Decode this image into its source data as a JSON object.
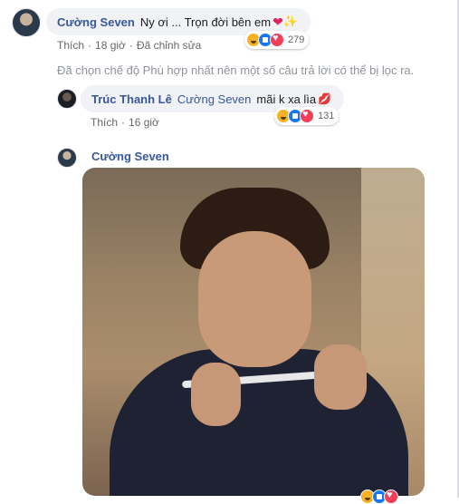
{
  "comments": [
    {
      "author": "Cường Seven",
      "text": "Ny ơi ... Trọn đời bên em",
      "emoji": "❤️✨",
      "like_label": "Thích",
      "time": "18 giờ",
      "edited": "Đã chỉnh sửa",
      "reaction_count": "279"
    }
  ],
  "filter_note": "Đã chọn chế độ Phù hợp nhất nên một số câu trả lời có thể bị lọc ra.",
  "reply": {
    "author": "Trúc Thanh Lê",
    "mention": "Cường Seven",
    "text": "mãi k xa lìa",
    "emoji": "💋",
    "like_label": "Thích",
    "time": "16 giờ",
    "reaction_count": "131"
  },
  "gif_reply": {
    "author": "Cường Seven"
  },
  "colors": {
    "link": "#385898",
    "bubble": "#f0f2f5",
    "meta": "#65676b"
  },
  "icons": {
    "haha": "haha-reaction-icon",
    "like": "like-reaction-icon",
    "love": "love-reaction-icon"
  }
}
